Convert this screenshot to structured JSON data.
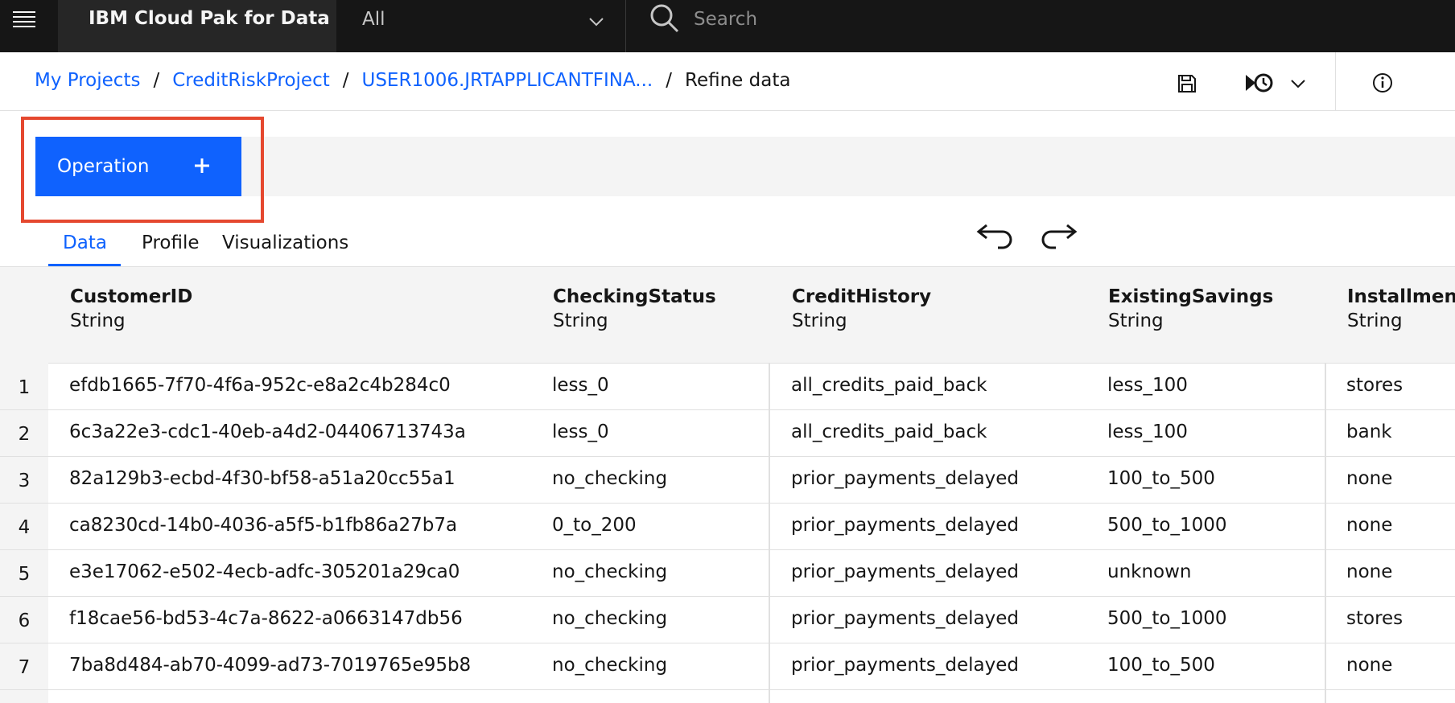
{
  "header": {
    "brand": "IBM Cloud Pak for Data",
    "scope_selected": "All",
    "search_placeholder": "Search"
  },
  "breadcrumb": {
    "items": [
      "My Projects",
      "CreditRiskProject",
      "USER1006.JRTAPPLICANTFINA..."
    ],
    "separator": "/",
    "current": "Refine data"
  },
  "operation_button": {
    "label": "Operation"
  },
  "tabs": [
    {
      "label": "Data",
      "active": true
    },
    {
      "label": "Profile",
      "active": false
    },
    {
      "label": "Visualizations",
      "active": false
    }
  ],
  "table": {
    "columns": [
      {
        "name": "CustomerID",
        "type": "String"
      },
      {
        "name": "CheckingStatus",
        "type": "String"
      },
      {
        "name": "CreditHistory",
        "type": "String"
      },
      {
        "name": "ExistingSavings",
        "type": "String"
      },
      {
        "name": "InstallmentPlans",
        "type": "String"
      }
    ],
    "rows": [
      {
        "num": "1",
        "cells": [
          "efdb1665-7f70-4f6a-952c-e8a2c4b284c0",
          "less_0",
          "all_credits_paid_back",
          "less_100",
          "stores"
        ]
      },
      {
        "num": "2",
        "cells": [
          "6c3a22e3-cdc1-40eb-a4d2-04406713743a",
          "less_0",
          "all_credits_paid_back",
          "less_100",
          "bank"
        ]
      },
      {
        "num": "3",
        "cells": [
          "82a129b3-ecbd-4f30-bf58-a51a20cc55a1",
          "no_checking",
          "prior_payments_delayed",
          "100_to_500",
          "none"
        ]
      },
      {
        "num": "4",
        "cells": [
          "ca8230cd-14b0-4036-a5f5-b1fb86a27b7a",
          "0_to_200",
          "prior_payments_delayed",
          "500_to_1000",
          "none"
        ]
      },
      {
        "num": "5",
        "cells": [
          "e3e17062-e502-4ecb-adfc-305201a29ca0",
          "no_checking",
          "prior_payments_delayed",
          "unknown",
          "none"
        ]
      },
      {
        "num": "6",
        "cells": [
          "f18cae56-bd53-4c7a-8622-a0663147db56",
          "no_checking",
          "prior_payments_delayed",
          "500_to_1000",
          "stores"
        ]
      },
      {
        "num": "7",
        "cells": [
          "7ba8d484-ab70-4099-ad73-7019765e95b8",
          "no_checking",
          "prior_payments_delayed",
          "100_to_500",
          "none"
        ]
      }
    ]
  },
  "colors": {
    "accent": "#0f62fe",
    "topbar": "#161616",
    "highlight": "#e5482f"
  }
}
